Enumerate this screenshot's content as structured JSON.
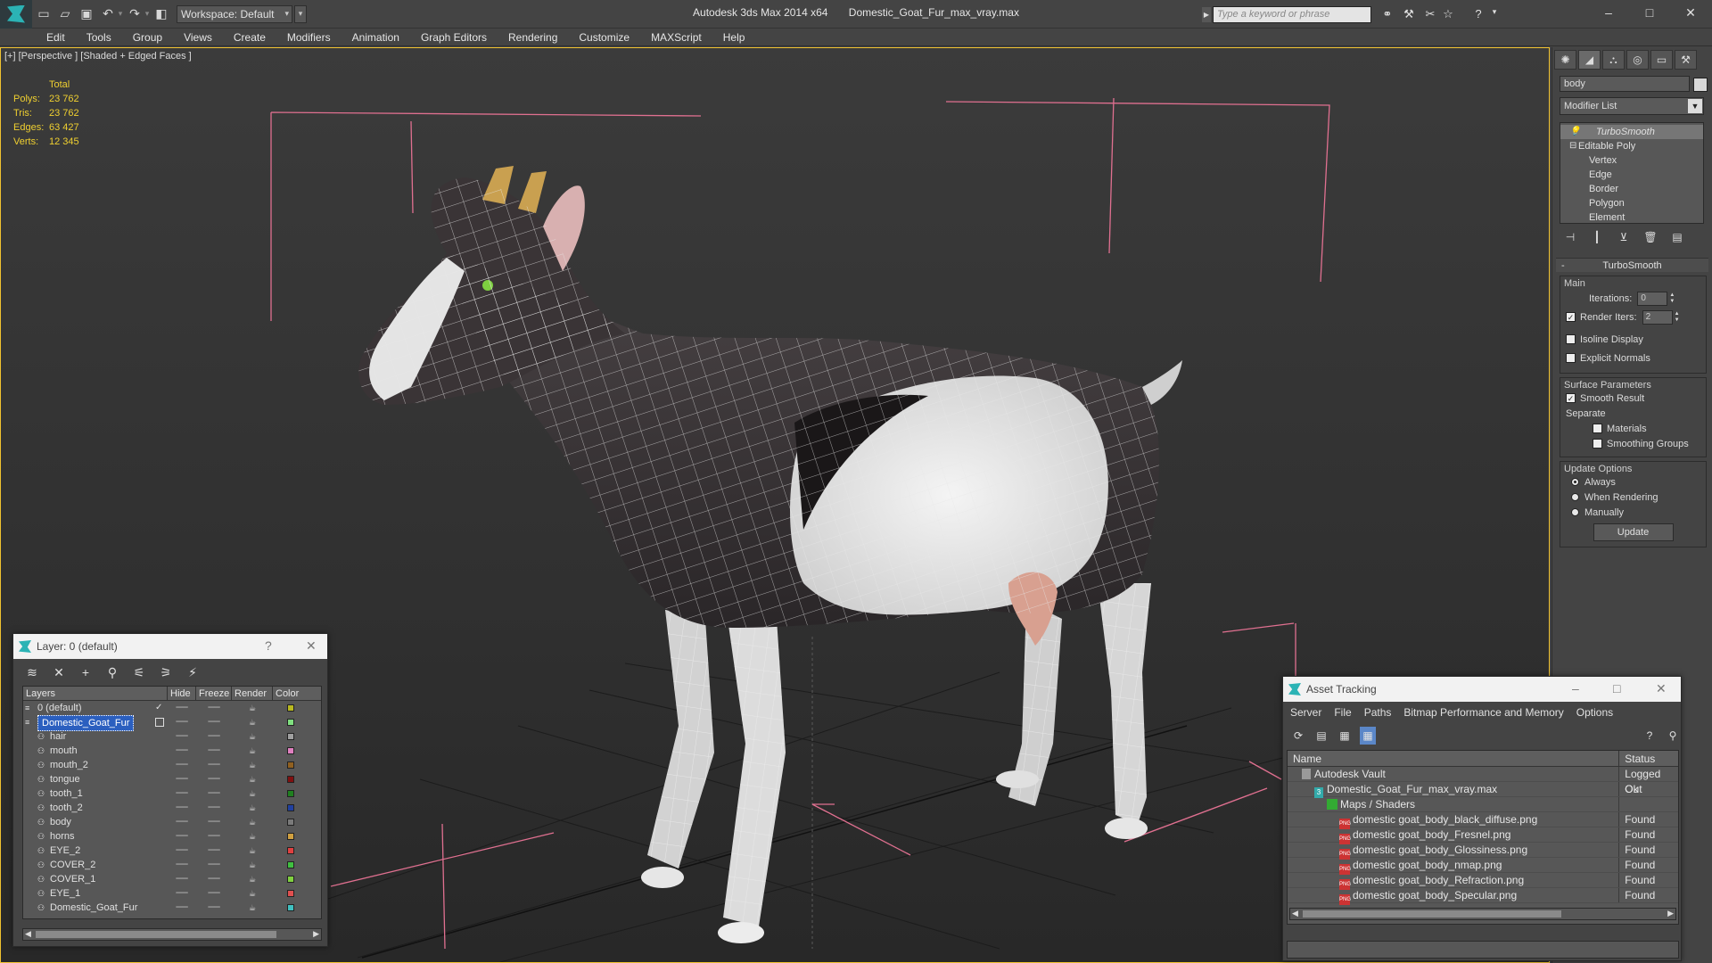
{
  "titlebar": {
    "workspace_label": "Workspace: Default",
    "app_title": "Autodesk 3ds Max  2014 x64",
    "file_title": "Domestic_Goat_Fur_max_vray.max",
    "search_placeholder": "Type a keyword or phrase"
  },
  "menubar": {
    "items": [
      "Edit",
      "Tools",
      "Group",
      "Views",
      "Create",
      "Modifiers",
      "Animation",
      "Graph Editors",
      "Rendering",
      "Customize",
      "MAXScript",
      "Help"
    ]
  },
  "viewport": {
    "label": "[+] [Perspective ] [Shaded + Edged Faces ]",
    "stats": {
      "header": "Total",
      "rows": [
        {
          "key": "Polys:",
          "value": "23 762"
        },
        {
          "key": "Tris:",
          "value": "23 762"
        },
        {
          "key": "Edges:",
          "value": "63 427"
        },
        {
          "key": "Verts:",
          "value": "12 345"
        }
      ]
    },
    "colors": {
      "stats": "#f0d030",
      "bbox": "#e07090",
      "grid": "#1c1c1c",
      "wire": "#ffffff"
    }
  },
  "command_panel": {
    "object_name": "body",
    "modifier_list": "Modifier List",
    "stack": {
      "top": "TurboSmooth",
      "base": "Editable Poly",
      "subs": [
        "Vertex",
        "Edge",
        "Border",
        "Polygon",
        "Element"
      ]
    },
    "rollout": {
      "title": "TurboSmooth",
      "main_group": "Main",
      "iterations_label": "Iterations:",
      "iterations_value": "0",
      "render_iters_label": "Render Iters:",
      "render_iters_value": "2",
      "isoline": "Isoline Display",
      "explicit": "Explicit Normals",
      "surface_group": "Surface Parameters",
      "smooth_result": "Smooth Result",
      "separate": "Separate",
      "materials": "Materials",
      "smoothing_groups": "Smoothing Groups",
      "update_group": "Update Options",
      "always": "Always",
      "when_rendering": "When Rendering",
      "manually": "Manually",
      "update_button": "Update"
    }
  },
  "layer_window": {
    "title": "Layer: 0 (default)",
    "help": "?",
    "headers": [
      "Layers",
      "Hide",
      "Freeze",
      "Render",
      "Color"
    ],
    "rows": [
      {
        "name": "0 (default)",
        "indent": 0,
        "check": "✓",
        "color": "#b8b820"
      },
      {
        "name": "Domestic_Goat_Fur",
        "indent": 0,
        "selected": true,
        "color": "#80e080"
      },
      {
        "name": "hair",
        "indent": 1,
        "color": "#a0a0a0"
      },
      {
        "name": "mouth",
        "indent": 1,
        "color": "#e080c0"
      },
      {
        "name": "mouth_2",
        "indent": 1,
        "color": "#906020"
      },
      {
        "name": "tongue",
        "indent": 1,
        "color": "#801010"
      },
      {
        "name": "tooth_1",
        "indent": 1,
        "color": "#208020"
      },
      {
        "name": "tooth_2",
        "indent": 1,
        "color": "#2040a0"
      },
      {
        "name": "body",
        "indent": 1,
        "color": "#7a7a7a"
      },
      {
        "name": "horns",
        "indent": 1,
        "color": "#d0a040"
      },
      {
        "name": "EYE_2",
        "indent": 1,
        "color": "#e04040"
      },
      {
        "name": "COVER_2",
        "indent": 1,
        "color": "#40c040"
      },
      {
        "name": "COVER_1",
        "indent": 1,
        "color": "#80d040"
      },
      {
        "name": "EYE_1",
        "indent": 1,
        "color": "#e05050"
      },
      {
        "name": "Domestic_Goat_Fur",
        "indent": 1,
        "color": "#40c0c0"
      }
    ]
  },
  "asset_window": {
    "title": "Asset Tracking",
    "menu": [
      "Server",
      "File",
      "Paths",
      "Bitmap Performance and Memory",
      "Options"
    ],
    "headers": [
      "Name",
      "Status"
    ],
    "rows": [
      {
        "name": "Autodesk Vault",
        "status": "Logged Out",
        "icon": "vault",
        "indent": 0
      },
      {
        "name": "Domestic_Goat_Fur_max_vray.max",
        "status": "Ok",
        "icon": "max",
        "indent": 1
      },
      {
        "name": "Maps / Shaders",
        "status": "",
        "icon": "maps",
        "indent": 2
      },
      {
        "name": "domestic goat_body_black_diffuse.png",
        "status": "Found",
        "icon": "png",
        "indent": 3
      },
      {
        "name": "domestic goat_body_Fresnel.png",
        "status": "Found",
        "icon": "png",
        "indent": 3
      },
      {
        "name": "domestic goat_body_Glossiness.png",
        "status": "Found",
        "icon": "png",
        "indent": 3
      },
      {
        "name": "domestic goat_body_nmap.png",
        "status": "Found",
        "icon": "png",
        "indent": 3
      },
      {
        "name": "domestic goat_body_Refraction.png",
        "status": "Found",
        "icon": "png",
        "indent": 3
      },
      {
        "name": "domestic goat_body_Specular.png",
        "status": "Found",
        "icon": "png",
        "indent": 3
      }
    ]
  }
}
